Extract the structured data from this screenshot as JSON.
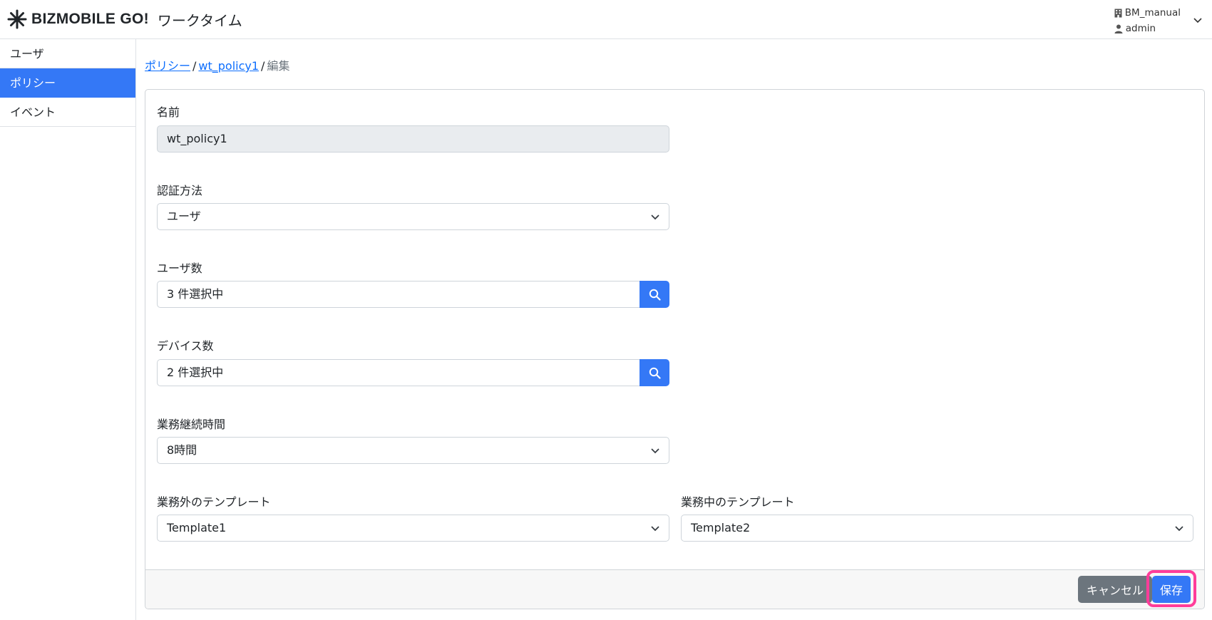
{
  "header": {
    "brand": "BIZMOBILE GO!",
    "app_name": "ワークタイム",
    "organization": "BM_manual",
    "user": "admin"
  },
  "sidebar": {
    "items": [
      {
        "label": "ユーザ"
      },
      {
        "label": "ポリシー",
        "active": true
      },
      {
        "label": "イベント"
      }
    ]
  },
  "breadcrumb": {
    "items": [
      "ポリシー",
      "wt_policy1",
      "編集"
    ],
    "separator": "/"
  },
  "form": {
    "name": {
      "label": "名前",
      "value": "wt_policy1"
    },
    "auth": {
      "label": "認証方法",
      "value": "ユーザ"
    },
    "users": {
      "label": "ユーザ数",
      "value": "3 件選択中"
    },
    "devices": {
      "label": "デバイス数",
      "value": "2 件選択中"
    },
    "duration": {
      "label": "業務継続時間",
      "value": "8時間"
    },
    "template_off": {
      "label": "業務外のテンプレート",
      "value": "Template1"
    },
    "template_on": {
      "label": "業務中のテンプレート",
      "value": "Template2"
    }
  },
  "footer": {
    "cancel_label": "キャンセル",
    "save_label": "保存"
  },
  "colors": {
    "primary": "#3478f6",
    "secondary": "#6c757d",
    "highlight": "#ff3d9a"
  }
}
